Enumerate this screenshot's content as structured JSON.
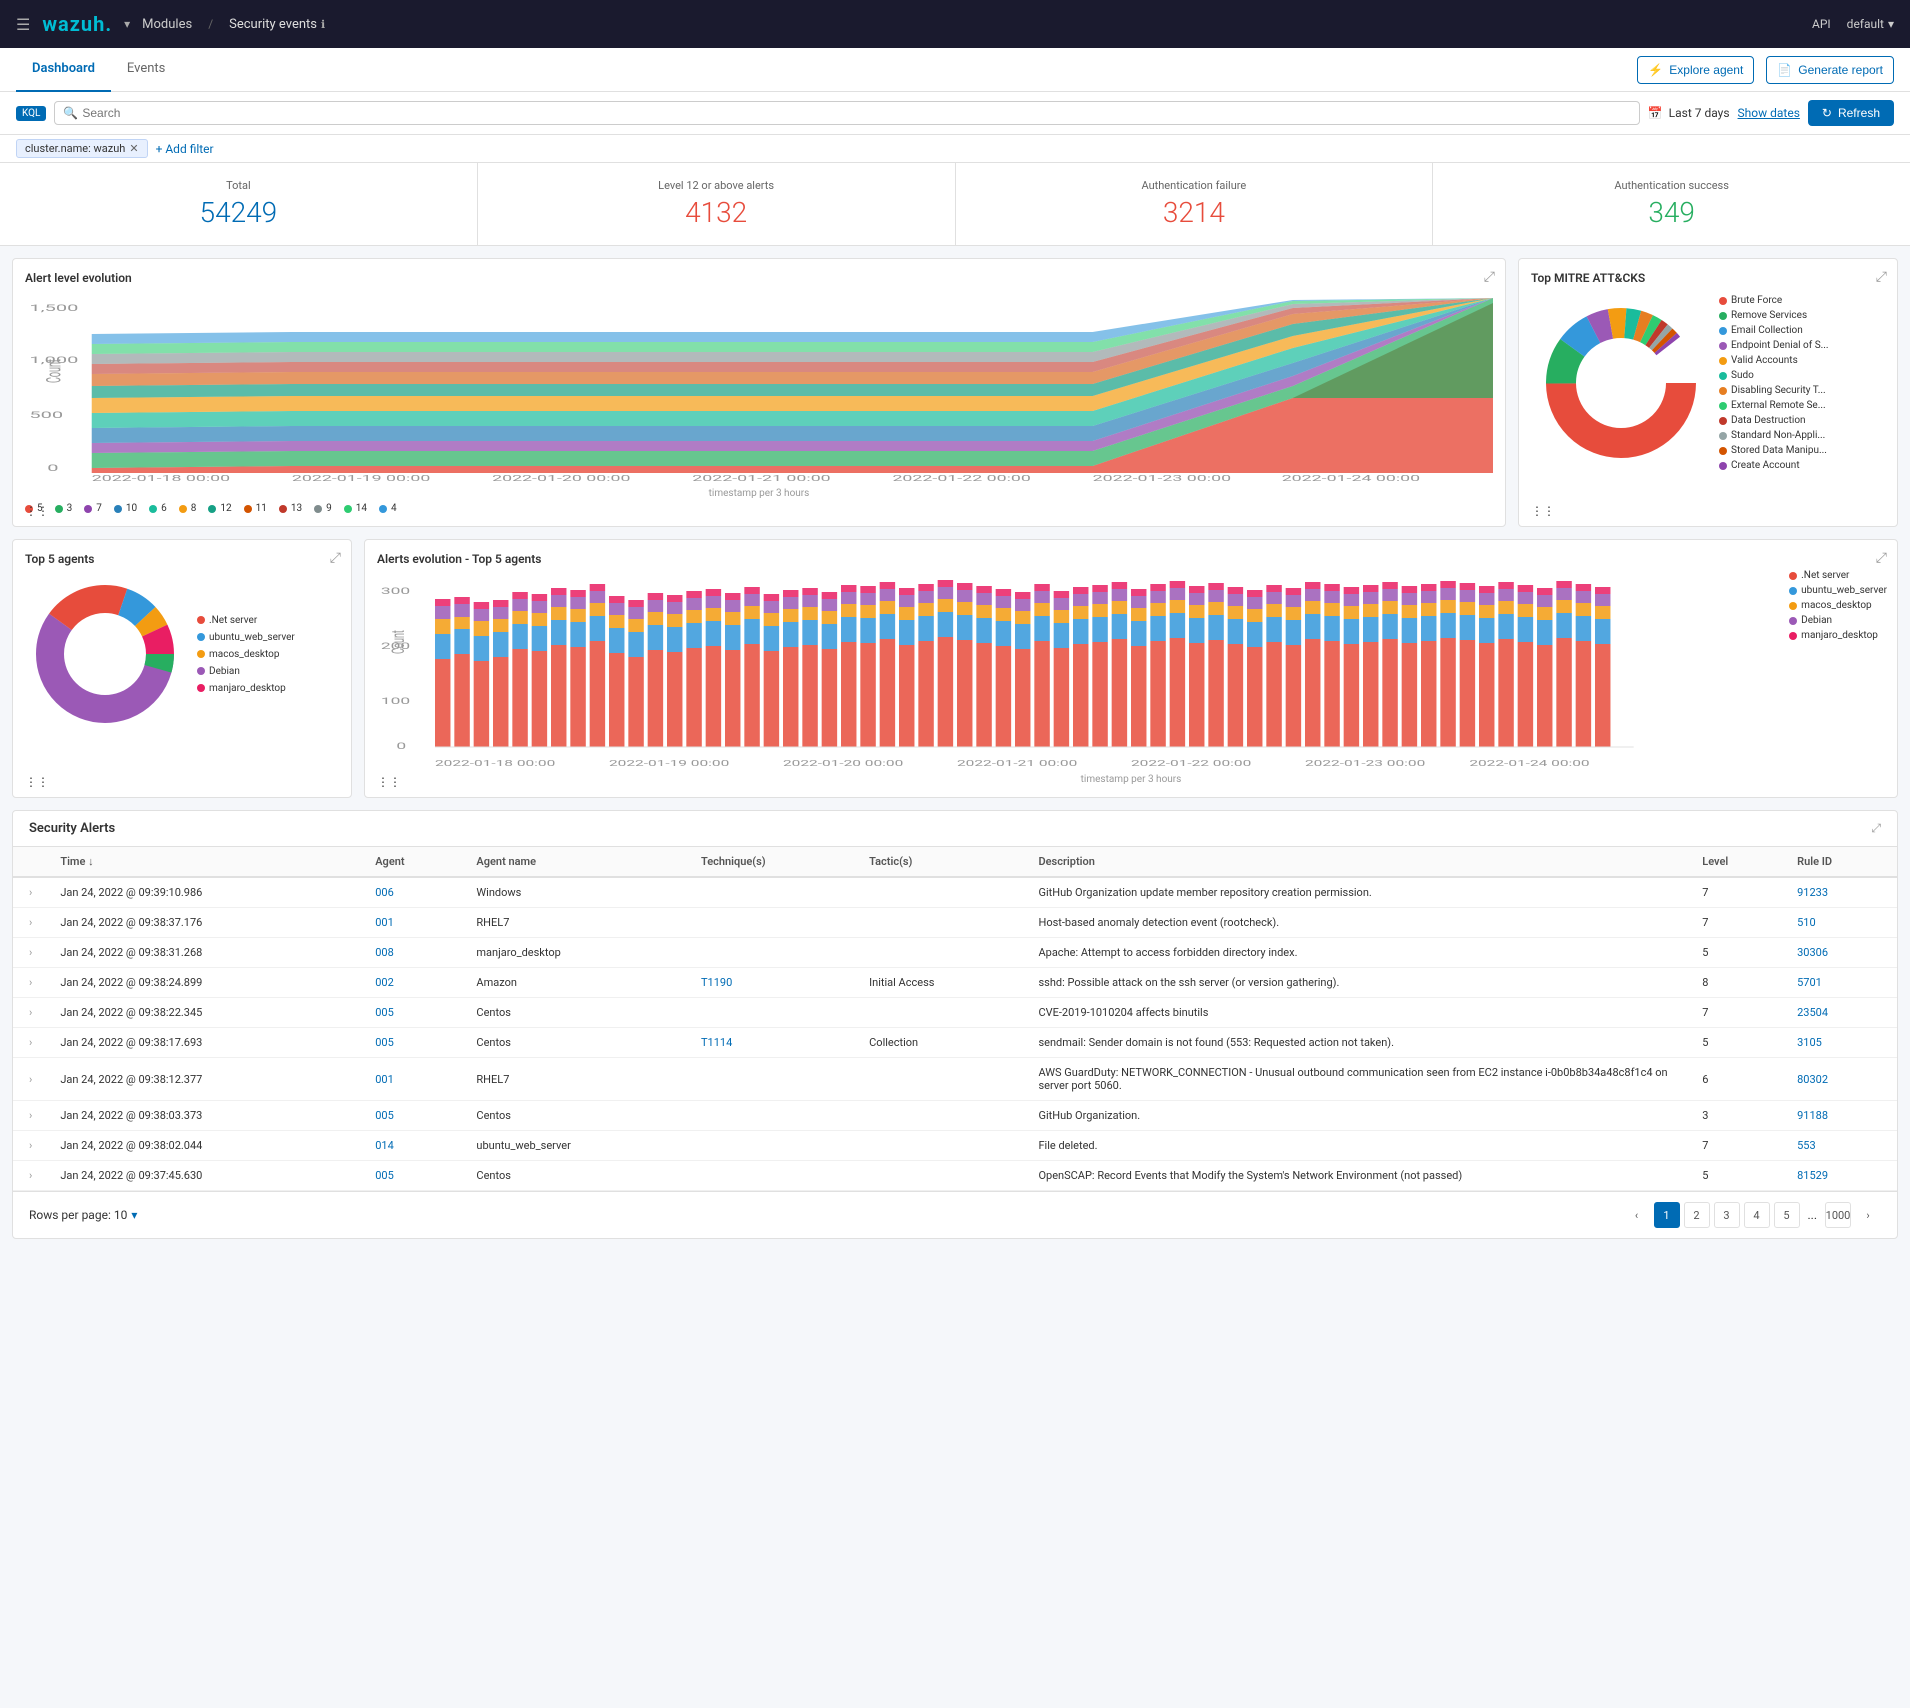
{
  "app": {
    "hamburger": "☰",
    "logo": "wazuh.",
    "modules": "Modules",
    "breadcrumb_sep": "/",
    "security_events": "Security events",
    "info_icon": "ℹ",
    "api": "API",
    "default": "default",
    "chevron": "▾"
  },
  "second_nav": {
    "tabs": [
      "Dashboard",
      "Events"
    ],
    "active_tab": "Dashboard",
    "explore_btn": "Explore agent",
    "generate_btn": "Generate report"
  },
  "search": {
    "kql_label": "KQL",
    "placeholder": "Search",
    "time_filter": "Last 7 days",
    "show_dates": "Show dates",
    "refresh": "Refresh",
    "filter_tag": "cluster.name: wazuh",
    "add_filter": "+ Add filter"
  },
  "stats": [
    {
      "label": "Total",
      "value": "54249",
      "color": "blue"
    },
    {
      "label": "Level 12 or above alerts",
      "value": "4132",
      "color": "red"
    },
    {
      "label": "Authentication failure",
      "value": "3214",
      "color": "red"
    },
    {
      "label": "Authentication success",
      "value": "349",
      "color": "green"
    }
  ],
  "alert_evolution": {
    "title": "Alert level evolution",
    "y_labels": [
      "1,500",
      "1,000",
      "500",
      "0"
    ],
    "x_labels": [
      "2022-01-18 00:00",
      "2022-01-19 00:00",
      "2022-01-20 00:00",
      "2022-01-21 00:00",
      "2022-01-22 00:00",
      "2022-01-23 00:00",
      "2022-01-24 00:00"
    ],
    "x_axis_label": "timestamp per 3 hours",
    "y_axis_label": "Count",
    "legend": [
      {
        "label": "5",
        "color": "#e74c3c"
      },
      {
        "label": "3",
        "color": "#27ae60"
      },
      {
        "label": "7",
        "color": "#8e44ad"
      },
      {
        "label": "10",
        "color": "#2980b9"
      },
      {
        "label": "6",
        "color": "#1abc9c"
      },
      {
        "label": "8",
        "color": "#f39c12"
      },
      {
        "label": "12",
        "color": "#16a085"
      },
      {
        "label": "11",
        "color": "#d35400"
      },
      {
        "label": "13",
        "color": "#c0392b"
      },
      {
        "label": "9",
        "color": "#7f8c8d"
      },
      {
        "label": "14",
        "color": "#2ecc71"
      },
      {
        "label": "4",
        "color": "#3498db"
      }
    ]
  },
  "mitre": {
    "title": "Top MITRE ATT&CKS",
    "legend": [
      {
        "label": "Brute Force",
        "color": "#e74c3c"
      },
      {
        "label": "Remove Services",
        "color": "#27ae60"
      },
      {
        "label": "Email Collection",
        "color": "#3498db"
      },
      {
        "label": "Endpoint Denial of S...",
        "color": "#9b59b6"
      },
      {
        "label": "Valid Accounts",
        "color": "#f39c12"
      },
      {
        "label": "Sudo",
        "color": "#1abc9c"
      },
      {
        "label": "Disabling Security T...",
        "color": "#e67e22"
      },
      {
        "label": "External Remote Se...",
        "color": "#2ecc71"
      },
      {
        "label": "Data Destruction",
        "color": "#e74c3c"
      },
      {
        "label": "Standard Non-Appli...",
        "color": "#95a5a6"
      },
      {
        "label": "Stored Data Manipu...",
        "color": "#d35400"
      },
      {
        "label": "Create Account",
        "color": "#8e44ad"
      }
    ]
  },
  "top5_agents": {
    "title": "Top 5 agents",
    "legend": [
      {
        "label": ".Net server",
        "color": "#e74c3c"
      },
      {
        "label": "ubuntu_web_server",
        "color": "#3498db"
      },
      {
        "label": "macos_desktop",
        "color": "#f39c12"
      },
      {
        "label": "Debian",
        "color": "#9b59b6"
      },
      {
        "label": "manjaro_desktop",
        "color": "#e91e63"
      }
    ]
  },
  "alerts_evolution": {
    "title": "Alerts evolution - Top 5 agents",
    "y_labels": [
      "300",
      "200",
      "100",
      "0"
    ],
    "x_labels": [
      "2022-01-18 00:00",
      "2022-01-19 00:00",
      "2022-01-20 00:00",
      "2022-01-21 00:00",
      "2022-01-22 00:00",
      "2022-01-23 00:00",
      "2022-01-24 00:00"
    ],
    "x_axis_label": "timestamp per 3 hours",
    "y_axis_label": "Count",
    "legend": [
      {
        "label": ".Net server",
        "color": "#e74c3c"
      },
      {
        "label": "ubuntu_web_server",
        "color": "#3498db"
      },
      {
        "label": "macos_desktop",
        "color": "#f39c12"
      },
      {
        "label": "Debian",
        "color": "#9b59b6"
      },
      {
        "label": "manjaro_desktop",
        "color": "#e91e63"
      }
    ]
  },
  "security_alerts": {
    "title": "Security Alerts",
    "columns": [
      "Time ↓",
      "Agent",
      "Agent name",
      "Technique(s)",
      "Tactic(s)",
      "Description",
      "Level",
      "Rule ID"
    ],
    "rows": [
      {
        "time": "Jan 24, 2022 @ 09:39:10.986",
        "agent": "006",
        "agent_name": "Windows",
        "technique": "",
        "tactic": "",
        "description": "GitHub Organization update member repository creation permission.",
        "level": "7",
        "rule_id": "91233"
      },
      {
        "time": "Jan 24, 2022 @ 09:38:37.176",
        "agent": "001",
        "agent_name": "RHEL7",
        "technique": "",
        "tactic": "",
        "description": "Host-based anomaly detection event (rootcheck).",
        "level": "7",
        "rule_id": "510"
      },
      {
        "time": "Jan 24, 2022 @ 09:38:31.268",
        "agent": "008",
        "agent_name": "manjaro_desktop",
        "technique": "",
        "tactic": "",
        "description": "Apache: Attempt to access forbidden directory index.",
        "level": "5",
        "rule_id": "30306"
      },
      {
        "time": "Jan 24, 2022 @ 09:38:24.899",
        "agent": "002",
        "agent_name": "Amazon",
        "technique": "T1190",
        "tactic": "Initial Access",
        "description": "sshd: Possible attack on the ssh server (or version gathering).",
        "level": "8",
        "rule_id": "5701"
      },
      {
        "time": "Jan 24, 2022 @ 09:38:22.345",
        "agent": "005",
        "agent_name": "Centos",
        "technique": "",
        "tactic": "",
        "description": "CVE-2019-1010204 affects binutils",
        "level": "7",
        "rule_id": "23504"
      },
      {
        "time": "Jan 24, 2022 @ 09:38:17.693",
        "agent": "005",
        "agent_name": "Centos",
        "technique": "T1114",
        "tactic": "Collection",
        "description": "sendmail: Sender domain is not found (553: Requested action not taken).",
        "level": "5",
        "rule_id": "3105"
      },
      {
        "time": "Jan 24, 2022 @ 09:38:12.377",
        "agent": "001",
        "agent_name": "RHEL7",
        "technique": "",
        "tactic": "",
        "description": "AWS GuardDuty: NETWORK_CONNECTION - Unusual outbound communication seen from EC2 instance i-0b0b8b34a48c8f1c4 on server port 5060.",
        "level": "6",
        "rule_id": "80302"
      },
      {
        "time": "Jan 24, 2022 @ 09:38:03.373",
        "agent": "005",
        "agent_name": "Centos",
        "technique": "",
        "tactic": "",
        "description": "GitHub Organization.",
        "level": "3",
        "rule_id": "91188"
      },
      {
        "time": "Jan 24, 2022 @ 09:38:02.044",
        "agent": "014",
        "agent_name": "ubuntu_web_server",
        "technique": "",
        "tactic": "",
        "description": "File deleted.",
        "level": "7",
        "rule_id": "553"
      },
      {
        "time": "Jan 24, 2022 @ 09:37:45.630",
        "agent": "005",
        "agent_name": "Centos",
        "technique": "",
        "tactic": "",
        "description": "OpenSCAP: Record Events that Modify the System's Network Environment (not passed)",
        "level": "5",
        "rule_id": "81529"
      }
    ]
  },
  "pagination": {
    "rows_per_page": "Rows per page: 10",
    "chevron": "▾",
    "prev": "‹",
    "next": "›",
    "pages": [
      "1",
      "2",
      "3",
      "4",
      "5"
    ],
    "current_page": "1",
    "last_page": "1000"
  }
}
